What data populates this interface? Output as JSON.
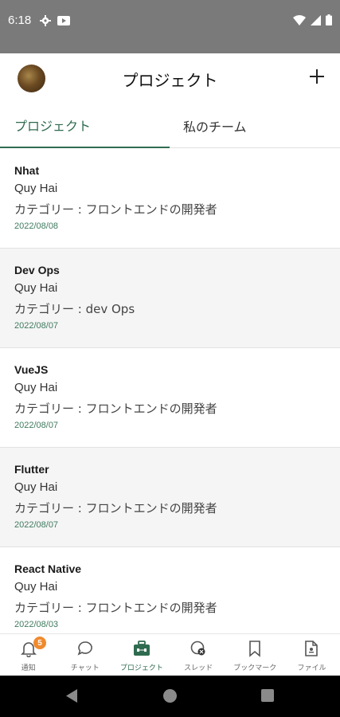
{
  "status_bar": {
    "time": "6:18"
  },
  "header": {
    "title": "プロジェクト"
  },
  "tabs": [
    {
      "label": "プロジェクト",
      "active": true
    },
    {
      "label": "私のチーム",
      "active": false
    }
  ],
  "projects": [
    {
      "name": "Nhat",
      "owner": "Quy Hai",
      "category": "カテゴリー : フロントエンドの開発者",
      "date": "2022/08/08"
    },
    {
      "name": "Dev Ops",
      "owner": "Quy Hai",
      "category": "カテゴリー : dev Ops",
      "date": "2022/08/07"
    },
    {
      "name": "VueJS",
      "owner": "Quy Hai",
      "category": "カテゴリー : フロントエンドの開発者",
      "date": "2022/08/07"
    },
    {
      "name": "Flutter",
      "owner": "Quy Hai",
      "category": "カテゴリー : フロントエンドの開発者",
      "date": "2022/08/07"
    },
    {
      "name": "React Native",
      "owner": "Quy Hai",
      "category": "カテゴリー : フロントエンドの開発者",
      "date": "2022/08/03"
    }
  ],
  "bottom_nav": [
    {
      "label": "通知",
      "icon": "bell-icon",
      "badge": "5"
    },
    {
      "label": "チャット",
      "icon": "chat-icon"
    },
    {
      "label": "プロジェクト",
      "icon": "briefcase-icon",
      "active": true
    },
    {
      "label": "スレッド",
      "icon": "thread-icon"
    },
    {
      "label": "ブックマーク",
      "icon": "bookmark-icon"
    },
    {
      "label": "ファイル",
      "icon": "file-icon"
    }
  ],
  "colors": {
    "accent": "#2f6b4f",
    "badge": "#f08a2e",
    "status_bar": "#7a7a7a"
  }
}
